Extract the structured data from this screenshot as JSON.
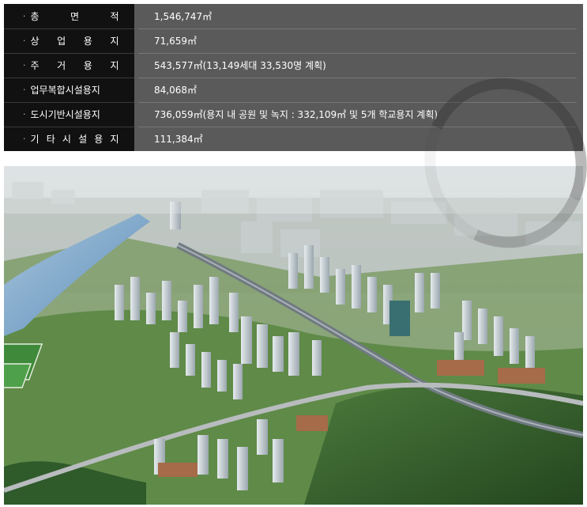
{
  "land_use_table": {
    "rows": [
      {
        "label": "총 면 적",
        "value": "1,546,747㎡"
      },
      {
        "label": "상 업 용 지",
        "value": "71,659㎡"
      },
      {
        "label": "주 거 용 지",
        "value": "543,577㎡(13,149세대 33,530명 계획)"
      },
      {
        "label": "업무복합시설용지",
        "value": "84,068㎡"
      },
      {
        "label": "도시기반시설용지",
        "value": "736,059㎡(용지 내 공원 및 녹지 : 332,109㎡ 및 5개 학교용지 계획)"
      },
      {
        "label": "기 타 시 설 용 지",
        "value": "111,384㎡"
      }
    ],
    "bullet": "·"
  },
  "colors": {
    "table_bg": "#5a5a5a",
    "label_bg": "#111111",
    "text": "#ffffff",
    "forest": "#2f5a2a",
    "river": "#6f9fc8",
    "park": "#4a8a3a"
  }
}
